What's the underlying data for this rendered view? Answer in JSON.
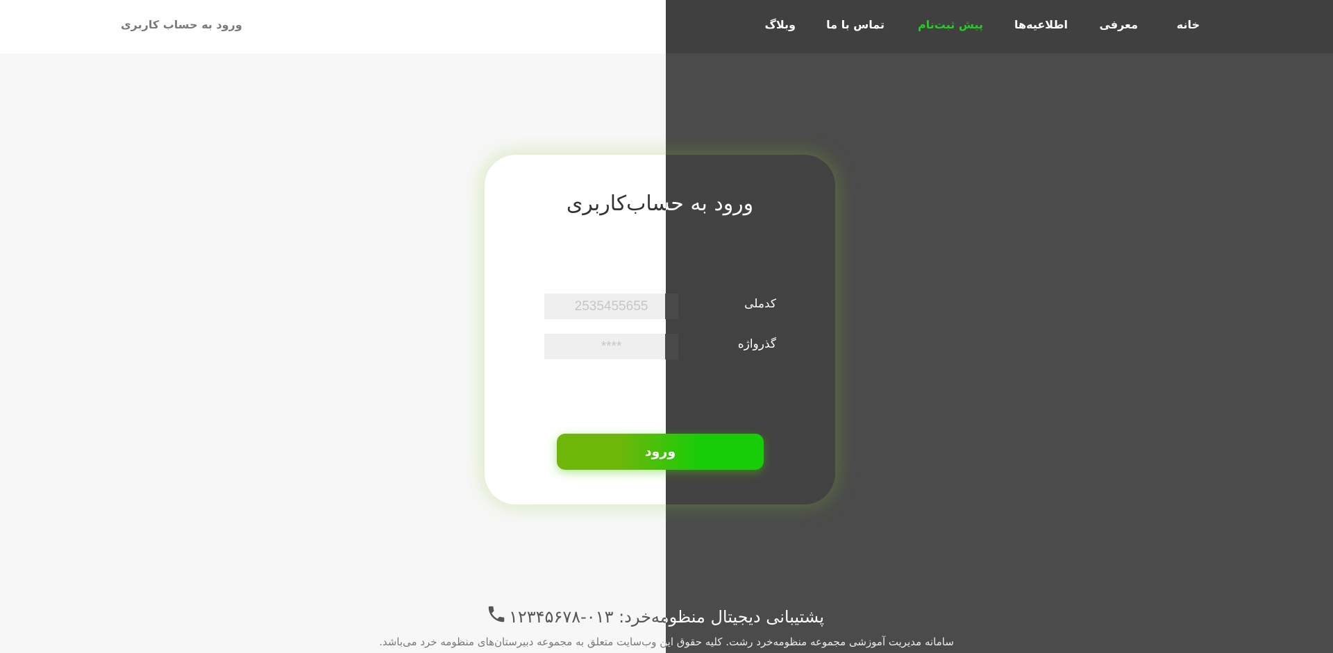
{
  "header": {
    "brand_link": "ورود به حساب کاربری",
    "nav": [
      {
        "label": "خانه",
        "active": false
      },
      {
        "label": "معرفی",
        "active": false
      },
      {
        "label": "اطلاعیه‌ها",
        "active": false
      },
      {
        "label": "پیش ثبت‌نام",
        "active": true
      },
      {
        "label": "تماس با ما",
        "active": false
      },
      {
        "label": "وبلاگ",
        "active": false
      }
    ]
  },
  "login_card": {
    "title": "ورود به حساب‌کاربری",
    "national_code": {
      "label": "کدملی",
      "placeholder": "2535455655"
    },
    "password": {
      "label": "گذرواژه",
      "placeholder": "****"
    },
    "submit_label": "ورود"
  },
  "footer": {
    "support": "پشتیبانی دیجیتال منظومه‌خرد: ۰۱۳-۱۲۳۴۵۶۷۸",
    "copyright": "سامانه مدیریت آموزشی مجموعه منظومه‌خرد رشت. کلیه حقوق این وب‌سایت متعلق به مجموعه دبیرستان‌های منظومه خرد می‌باشد."
  },
  "colors": {
    "accent_green": "#22cc22",
    "dark_half": "#4b4b4b",
    "light_half": "#f7f7f7"
  }
}
